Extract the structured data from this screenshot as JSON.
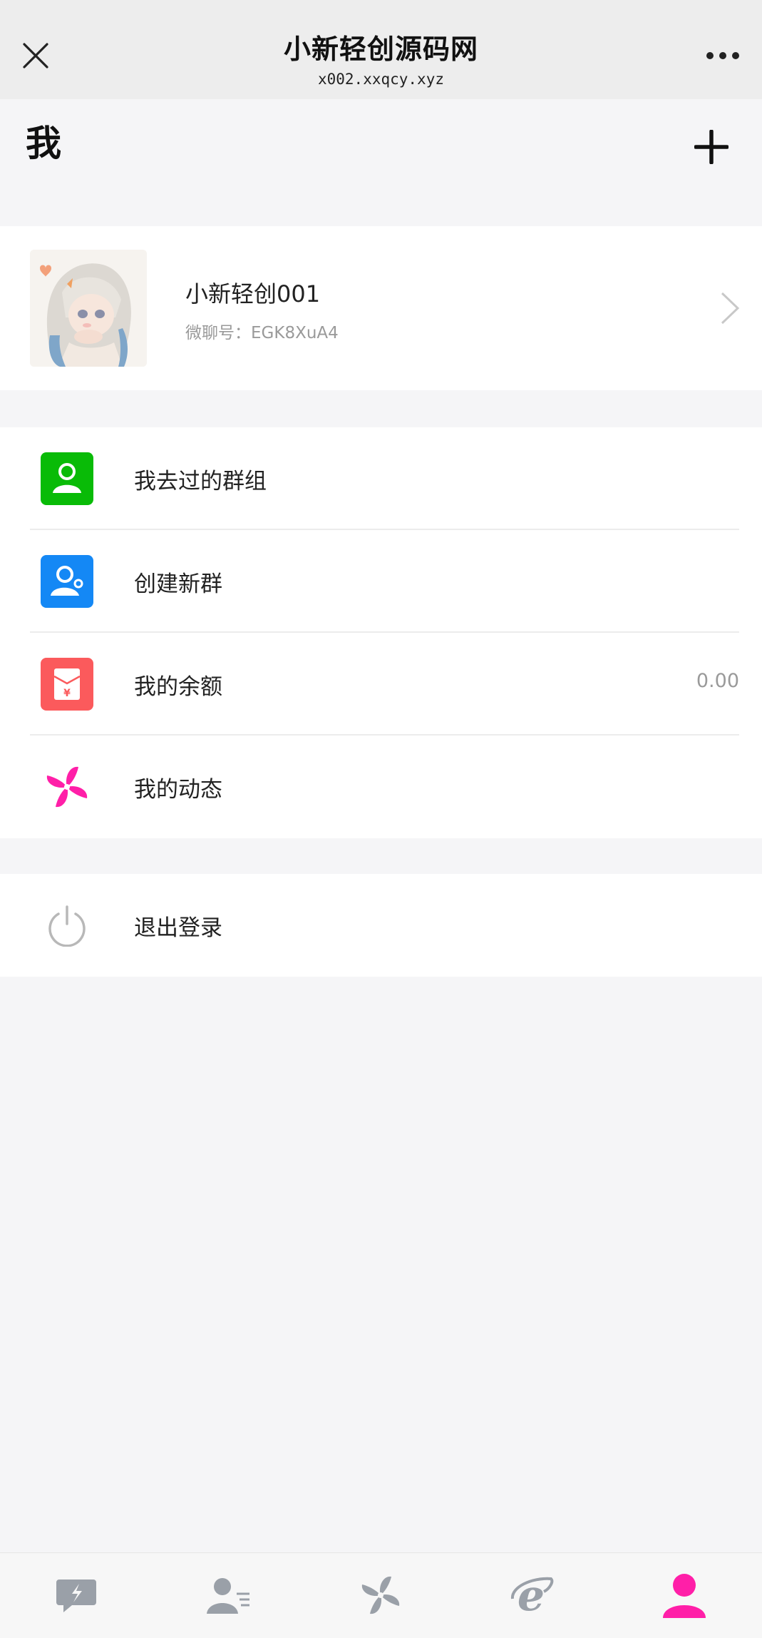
{
  "nav": {
    "title": "小新轻创源码网",
    "subtitle": "x002.xxqcy.xyz",
    "close_icon": "close-icon",
    "more_icon": "more-icon"
  },
  "page": {
    "title": "我",
    "add_icon": "plus-icon"
  },
  "profile": {
    "name": "小新轻创001",
    "id_label": "微聊号：",
    "id_value": "EGK8XuA4"
  },
  "menu": [
    {
      "label": "我去过的群组",
      "icon": "group-icon",
      "color": "#09bb07",
      "value": ""
    },
    {
      "label": "创建新群",
      "icon": "create-group-icon",
      "color": "#1488f5",
      "value": ""
    },
    {
      "label": "我的余额",
      "icon": "wallet-icon",
      "color": "#fb5a5c",
      "value": "0.00"
    },
    {
      "label": "我的动态",
      "icon": "pinwheel-icon",
      "color": "#ff1fa8",
      "value": ""
    }
  ],
  "logout": {
    "label": "退出登录",
    "icon": "power-icon"
  },
  "tabs": [
    {
      "label": "",
      "icon": "chat-icon",
      "active": false
    },
    {
      "label": "",
      "icon": "contacts-icon",
      "active": false
    },
    {
      "label": "",
      "icon": "pinwheel-icon",
      "active": false
    },
    {
      "label": "",
      "icon": "explore-icon",
      "active": false
    },
    {
      "label": "",
      "icon": "profile-icon",
      "active": true
    }
  ],
  "colors": {
    "accent": "#ff1fa8",
    "background": "#f5f5f7",
    "navbar": "#ededed"
  }
}
